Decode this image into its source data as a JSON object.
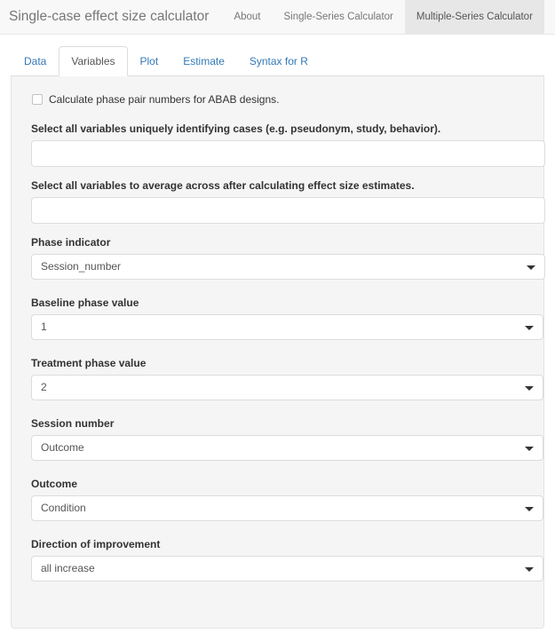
{
  "navbar": {
    "brand": "Single-case effect size calculator",
    "items": [
      {
        "label": "About",
        "active": false
      },
      {
        "label": "Single-Series Calculator",
        "active": false
      },
      {
        "label": "Multiple-Series Calculator",
        "active": true
      }
    ]
  },
  "tabs": [
    {
      "label": "Data",
      "active": false
    },
    {
      "label": "Variables",
      "active": true
    },
    {
      "label": "Plot",
      "active": false
    },
    {
      "label": "Estimate",
      "active": false
    },
    {
      "label": "Syntax for R",
      "active": false
    }
  ],
  "form": {
    "abab_checkbox": {
      "label": "Calculate phase pair numbers for ABAB designs.",
      "checked": false
    },
    "case_vars": {
      "label": "Select all variables uniquely identifying cases (e.g. pseudonym, study, behavior).",
      "value": "",
      "placeholder": ""
    },
    "average_vars": {
      "label": "Select all variables to average across after calculating effect size estimates.",
      "value": "",
      "placeholder": ""
    },
    "phase_indicator": {
      "label": "Phase indicator",
      "value": "Session_number"
    },
    "baseline_phase": {
      "label": "Baseline phase value",
      "value": "1"
    },
    "treatment_phase": {
      "label": "Treatment phase value",
      "value": "2"
    },
    "session_number": {
      "label": "Session number",
      "value": "Outcome"
    },
    "outcome": {
      "label": "Outcome",
      "value": "Condition"
    },
    "direction": {
      "label": "Direction of improvement",
      "value": "all increase"
    }
  },
  "icons": {
    "caret": "chevron-down-icon"
  },
  "colors": {
    "link": "#337ab7",
    "panel_bg": "#f5f5f5",
    "navbar_bg": "#f8f8f8",
    "navbar_active_bg": "#e7e7e7"
  }
}
